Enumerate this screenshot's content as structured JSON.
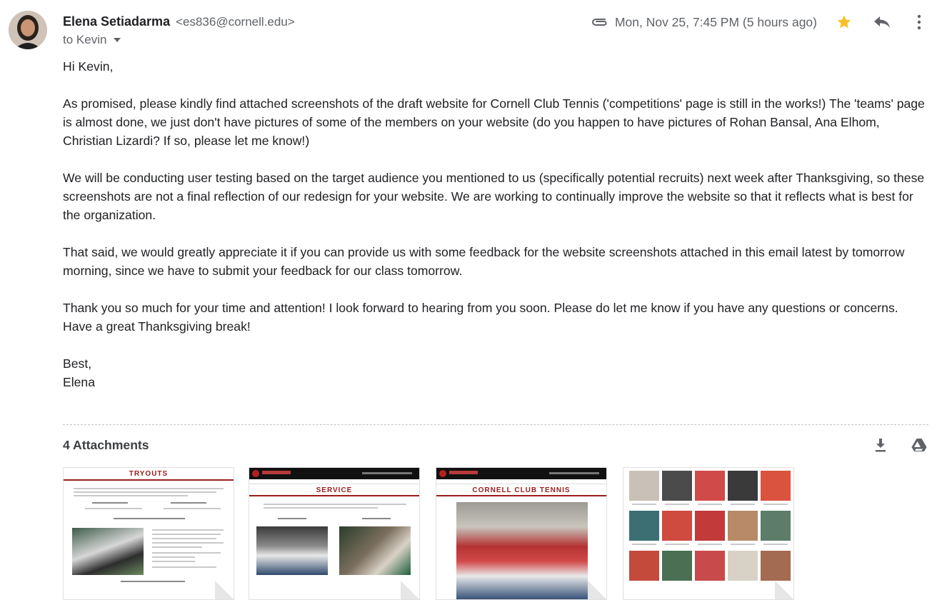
{
  "sender": {
    "name": "Elena Setiadarma",
    "email": "<es836@cornell.edu>",
    "to": "to Kevin"
  },
  "meta": {
    "date": "Mon, Nov 25, 7:45 PM (5 hours ago)",
    "icons": [
      "paperclip-icon",
      "star-icon",
      "reply-icon",
      "more-icon"
    ],
    "star_color": "#f6c02a"
  },
  "body": {
    "greeting": "Hi Kevin,",
    "p1": "As promised, please kindly find attached screenshots of the draft website for Cornell Club Tennis ('competitions' page is still in the works!) The 'teams' page is almost done, we just don't have pictures of some of the members on your website (do you happen to have pictures of Rohan Bansal, Ana Elhom, Christian Lizardi? If so, please let me know!)",
    "p2": "We will be conducting user testing based on the target audience you mentioned to us (specifically potential recruits) next week after Thanksgiving, so these screenshots are not a final reflection of our redesign for your website. We are working to continually improve the website so that it reflects what is best for the organization.",
    "p3": "That said, we would greatly appreciate it if you can provide us with some feedback for the website screenshots attached in this email latest by tomorrow morning, since we have to submit your feedback for our class tomorrow.",
    "p4": "Thank you so much for your time and attention! I look forward to hearing from you soon. Please do let me know if you have any questions or concerns. Have a great Thanksgiving break!",
    "closing": "Best,",
    "signature": "Elena"
  },
  "attachments": {
    "title": "4 Attachments",
    "items": [
      {
        "heading": "TRYOUTS"
      },
      {
        "heading": "SERVICE"
      },
      {
        "heading": "CORNELL CLUB TENNIS"
      },
      {
        "heading": ""
      }
    ]
  },
  "colors": {
    "accent_red": "#9b1c1c",
    "text": "#202124",
    "muted": "#5f6368"
  }
}
